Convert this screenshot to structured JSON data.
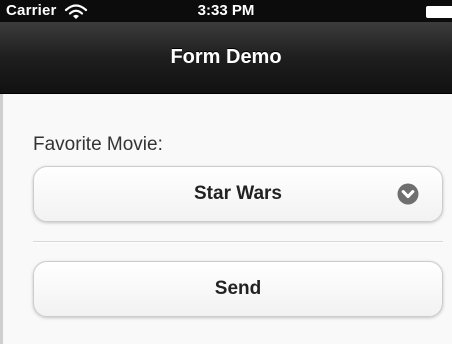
{
  "status_bar": {
    "carrier": "Carrier",
    "time": "3:33 PM",
    "wifi_icon": "wifi-icon",
    "battery_icon": "battery-icon"
  },
  "nav": {
    "title": "Form Demo"
  },
  "form": {
    "label": "Favorite Movie:",
    "select": {
      "selected": "Star Wars",
      "icon": "chevron-down-circle-icon"
    },
    "submit_label": "Send"
  },
  "colors": {
    "status_bar_bg": "#0c0c0c",
    "nav_bar_bg": "#1e1e1e",
    "content_bg": "#f9f9f9",
    "button_bg": "#f2f2f2",
    "icon_gray": "#6f6f6f"
  }
}
